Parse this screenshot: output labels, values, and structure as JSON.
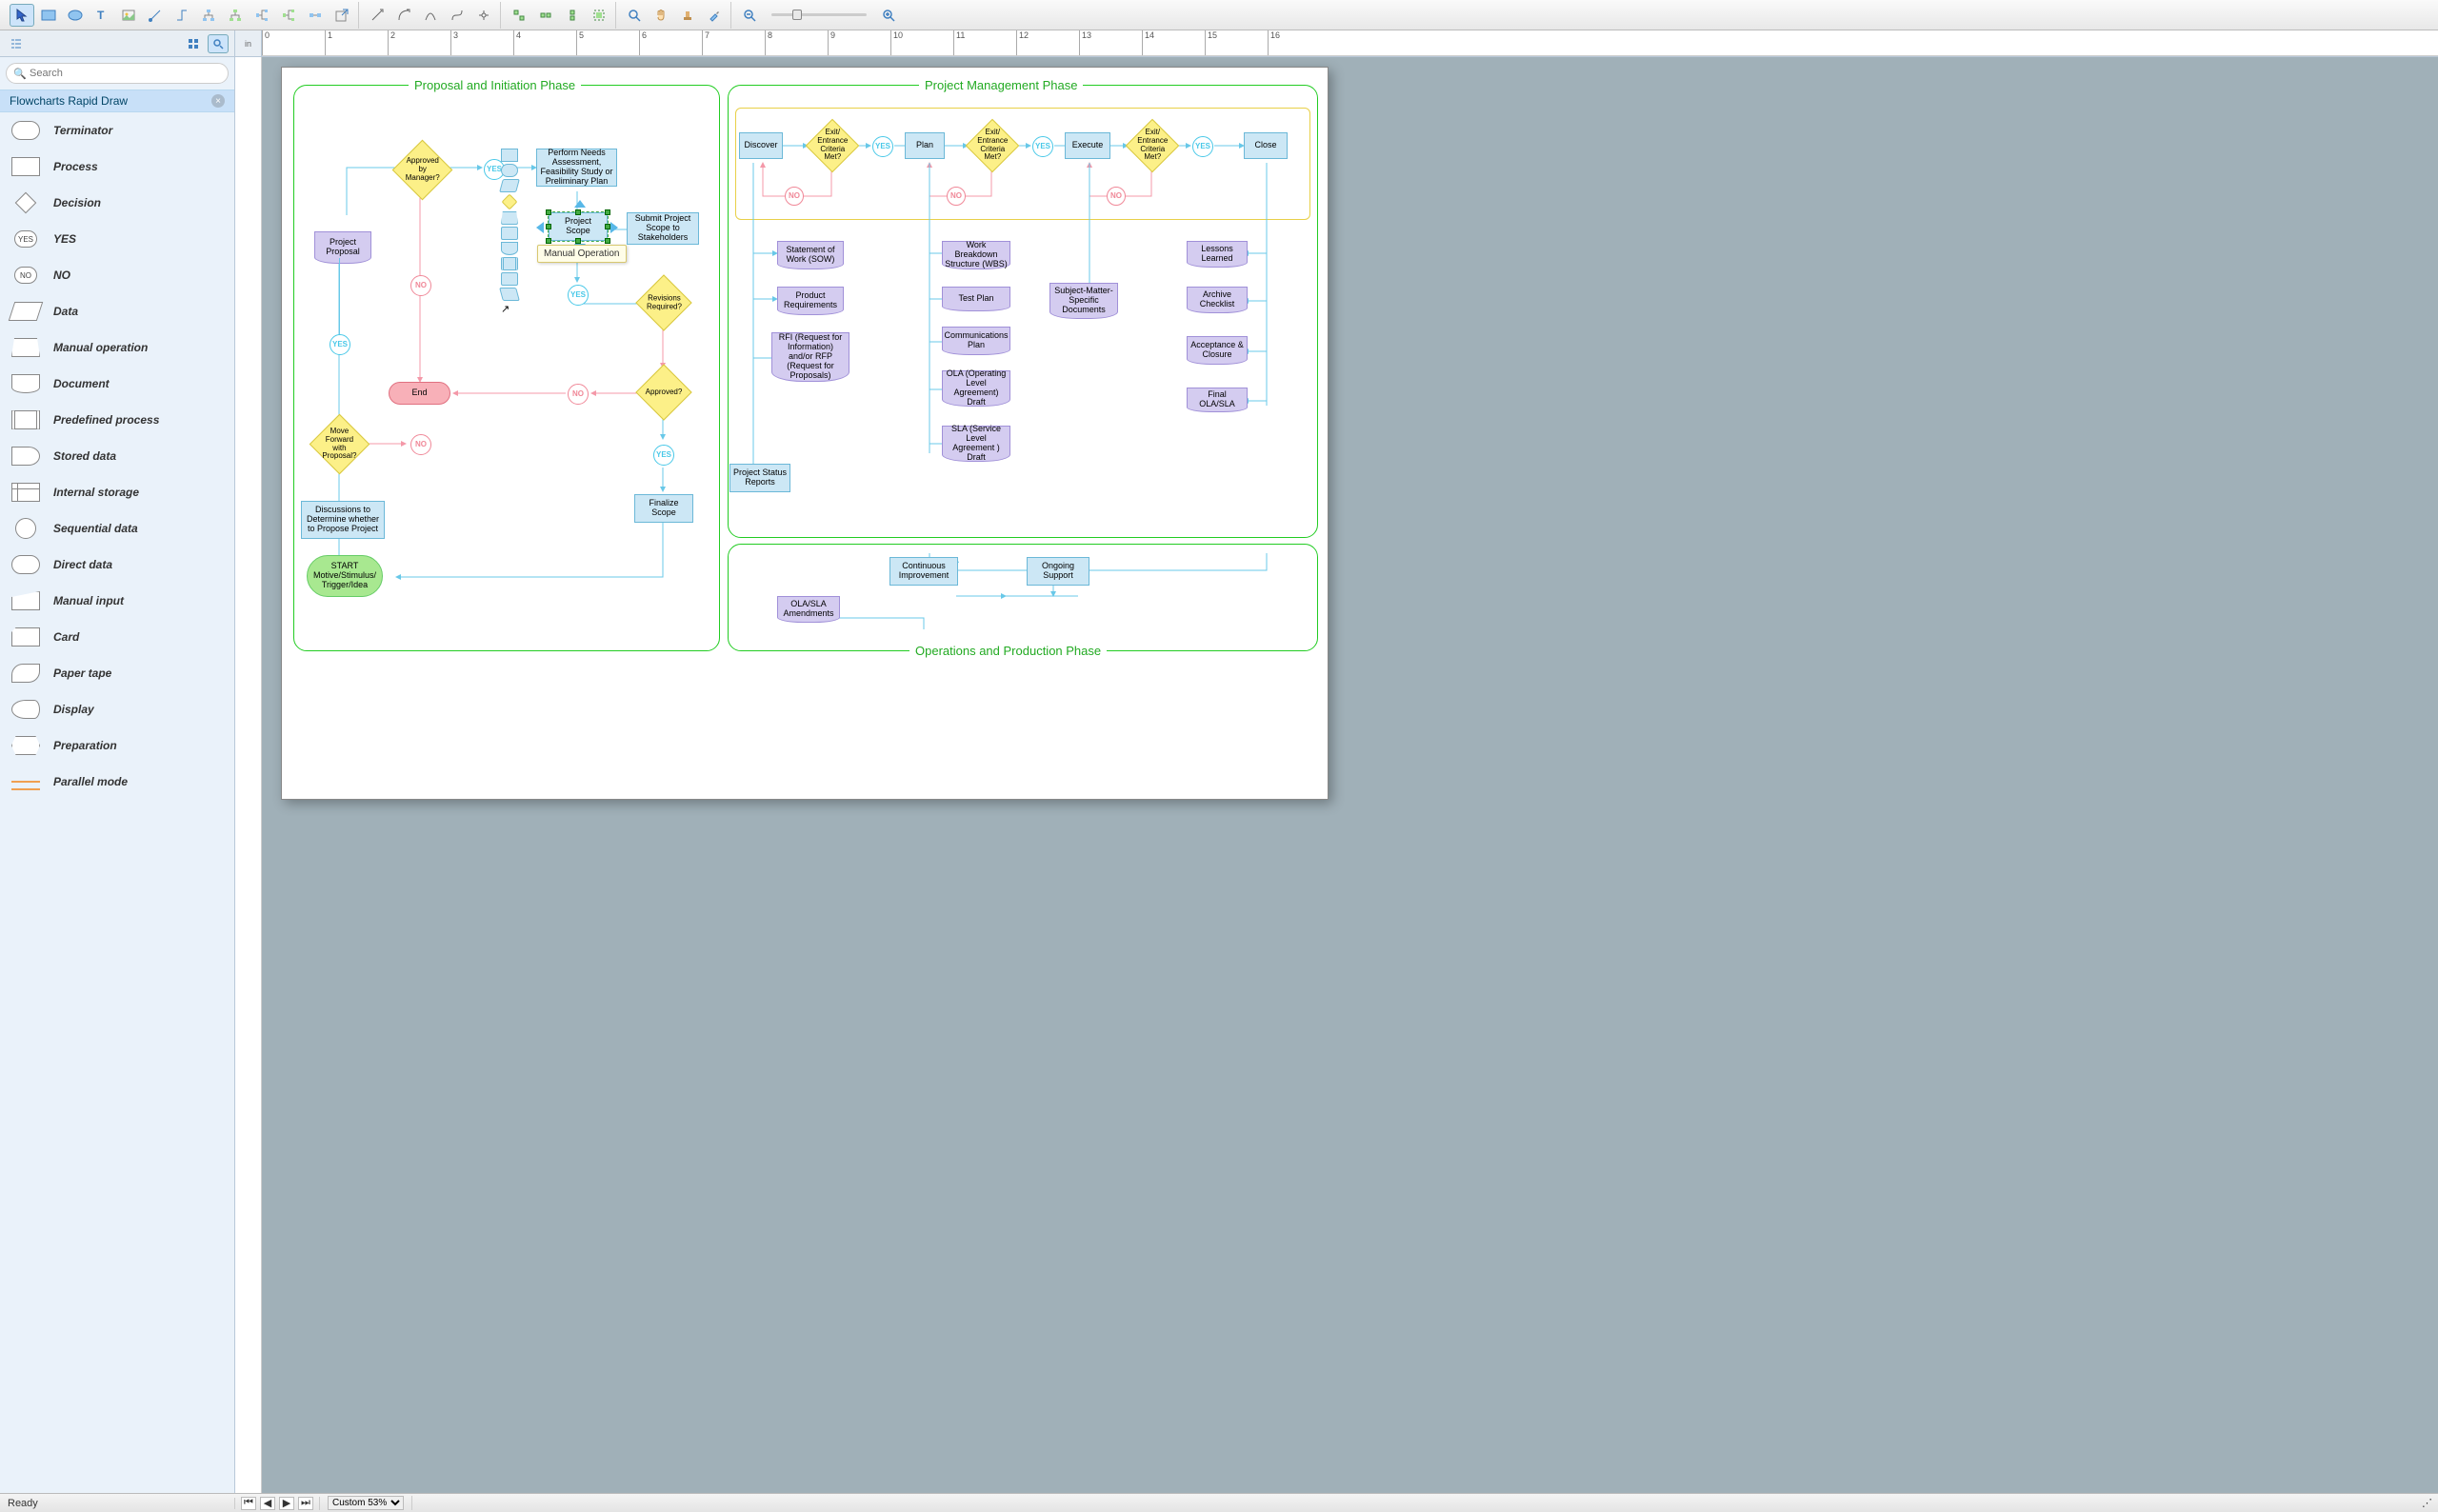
{
  "toolbar": {
    "groups": [
      [
        "pointer",
        "rectangle",
        "ellipse",
        "text",
        "image",
        "path",
        "angle-conn",
        "tree1",
        "tree2",
        "tree3",
        "tree4",
        "tree5",
        "export"
      ],
      [
        "conn-straight",
        "conn-curve",
        "conn-s",
        "conn-angle",
        "conn-split"
      ],
      [
        "align-group",
        "align-dist",
        "align-same",
        "align-snap"
      ],
      [
        "zoom-area",
        "hand",
        "stamp",
        "eyedropper"
      ],
      [
        "zoom-out",
        "slider",
        "zoom-in"
      ]
    ]
  },
  "sub_toolbar": {
    "view_buttons": [
      "tree-icon",
      "grid-icon",
      "search-icon"
    ],
    "ruler_unit": "in",
    "ruler_marks": [
      "0",
      "1",
      "2",
      "3",
      "4",
      "5",
      "6",
      "7",
      "8",
      "9",
      "10",
      "11",
      "12",
      "13",
      "14",
      "15",
      "16"
    ]
  },
  "sidebar": {
    "search_placeholder": "Search",
    "library_title": "Flowcharts Rapid Draw",
    "shapes": [
      {
        "label": "Terminator",
        "icon": "terminator"
      },
      {
        "label": "Process",
        "icon": "process"
      },
      {
        "label": "Decision",
        "icon": "decision"
      },
      {
        "label": "YES",
        "icon": "yes"
      },
      {
        "label": "NO",
        "icon": "no"
      },
      {
        "label": "Data",
        "icon": "data"
      },
      {
        "label": "Manual operation",
        "icon": "manual-op"
      },
      {
        "label": "Document",
        "icon": "document"
      },
      {
        "label": "Predefined process",
        "icon": "predef"
      },
      {
        "label": "Stored data",
        "icon": "stored"
      },
      {
        "label": "Internal storage",
        "icon": "storage"
      },
      {
        "label": "Sequential data",
        "icon": "seq"
      },
      {
        "label": "Direct data",
        "icon": "direct"
      },
      {
        "label": "Manual input",
        "icon": "manual-in"
      },
      {
        "label": "Card",
        "icon": "card"
      },
      {
        "label": "Paper tape",
        "icon": "tape"
      },
      {
        "label": "Display",
        "icon": "display"
      },
      {
        "label": "Preparation",
        "icon": "prep"
      },
      {
        "label": "Parallel mode",
        "icon": "parallel"
      }
    ]
  },
  "canvas": {
    "tooltip": "Manual Operation",
    "phases": {
      "proposal": "Proposal and Initiation Phase",
      "pm": "Project Management Phase",
      "ops": "Operations and Production Phase"
    },
    "nodes": {
      "approved_by_mgr": "Approved by Manager?",
      "yes1": "YES",
      "no1": "NO",
      "perform_needs": "Perform Needs Assessment, Feasibility Study or Preliminary Plan",
      "project_proposal": "Project Proposal",
      "project_scope": "Project Scope",
      "submit_scope": "Submit Project Scope to Stakeholders",
      "revisions_required": "Revisions Required?",
      "yes2": "YES",
      "no2": "NO",
      "yes3": "YES",
      "no3": "NO",
      "yes4": "YES",
      "no4": "NO",
      "approved": "Approved?",
      "end": "End",
      "move_forward": "Move Forward with Proposal?",
      "discussions": "Discussions to Determine whether to Propose Project",
      "finalize": "Finalize Scope",
      "start": "START Motive/Stimulus/ Trigger/Idea",
      "discover": "Discover",
      "exit1": "Exit/ Entrance Criteria Met?",
      "plan": "Plan",
      "exit2": "Exit/ Entrance Criteria Met?",
      "execute": "Execute",
      "exit3": "Exit/ Entrance Criteria Met?",
      "close": "Close",
      "y_a": "YES",
      "y_b": "YES",
      "y_c": "YES",
      "n_a": "NO",
      "n_b": "NO",
      "n_c": "NO",
      "sow": "Statement of Work (SOW)",
      "prod_req": "Product Requirements",
      "rfi": "RFI (Request for Information) and/or RFP (Request for Proposals)",
      "status_reports": "Project Status Reports",
      "wbs": "Work Breakdown Structure (WBS)",
      "test_plan": "Test Plan",
      "comm_plan": "Communications Plan",
      "ola_draft": "OLA (Operating Level Agreement) Draft",
      "sla_draft": "SLA (Service Level Agreement ) Draft",
      "sme": "Subject-Matter-Specific Documents",
      "lessons": "Lessons Learned",
      "archive": "Archive Checklist",
      "acceptance": "Acceptance & Closure",
      "final_ola": "Final OLA/SLA",
      "cont_improve": "Continuous Improvement",
      "ongoing": "Ongoing Support",
      "ola_amend": "OLA/SLA Amendments"
    }
  },
  "statusbar": {
    "ready": "Ready",
    "nav": [
      "first",
      "prev",
      "next",
      "last"
    ],
    "zoom_label": "Custom 53%"
  }
}
